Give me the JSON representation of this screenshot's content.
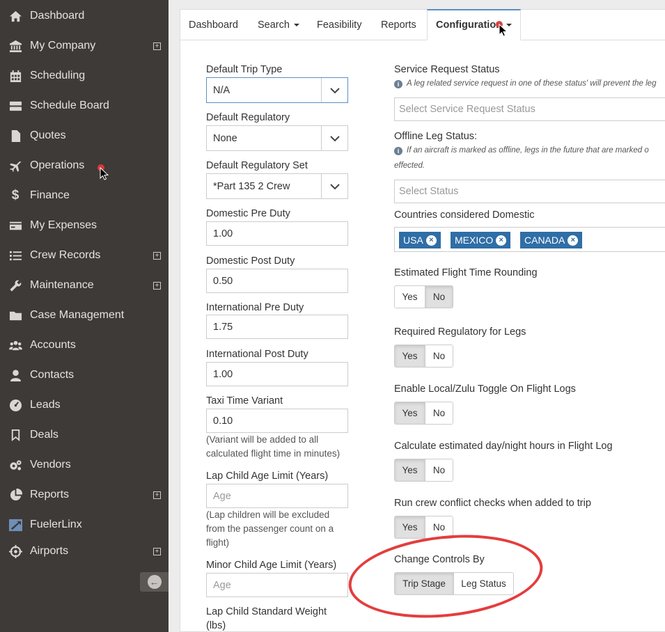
{
  "sidebar": {
    "items": [
      {
        "label": "Dashboard",
        "icon": "home-icon",
        "plus": false
      },
      {
        "label": "My Company",
        "icon": "bank-icon",
        "plus": true
      },
      {
        "label": "Scheduling",
        "icon": "calendar-icon",
        "plus": false
      },
      {
        "label": "Schedule Board",
        "icon": "board-icon",
        "plus": false
      },
      {
        "label": "Quotes",
        "icon": "document-icon",
        "plus": false
      },
      {
        "label": "Operations",
        "icon": "plane-icon",
        "plus": false
      },
      {
        "label": "Finance",
        "icon": "dollar-icon",
        "plus": false
      },
      {
        "label": "My Expenses",
        "icon": "credit-card-icon",
        "plus": false
      },
      {
        "label": "Crew Records",
        "icon": "list-icon",
        "plus": true
      },
      {
        "label": "Maintenance",
        "icon": "wrench-icon",
        "plus": true
      },
      {
        "label": "Case Management",
        "icon": "folder-icon",
        "plus": false
      },
      {
        "label": "Accounts",
        "icon": "users-icon",
        "plus": false
      },
      {
        "label": "Contacts",
        "icon": "user-icon",
        "plus": false
      },
      {
        "label": "Leads",
        "icon": "gauge-icon",
        "plus": false
      },
      {
        "label": "Deals",
        "icon": "bookmark-icon",
        "plus": false
      },
      {
        "label": "Vendors",
        "icon": "gears-icon",
        "plus": false
      },
      {
        "label": "Reports",
        "icon": "pie-chart-icon",
        "plus": true
      },
      {
        "label": "FuelerLinx",
        "icon": "fuelerlinx-icon",
        "plus": false
      },
      {
        "label": "Airports",
        "icon": "crosshair-icon",
        "plus": true
      }
    ],
    "plus_symbol": "+",
    "collapse_symbol": "←"
  },
  "tabs": [
    {
      "label": "Dashboard",
      "caret": false
    },
    {
      "label": "Search",
      "caret": true
    },
    {
      "label": "Feasibility",
      "caret": false
    },
    {
      "label": "Reports",
      "caret": false
    },
    {
      "label": "Configuration",
      "caret": true,
      "active": true
    }
  ],
  "left_form": {
    "default_trip_type": {
      "label": "Default Trip Type",
      "value": "N/A"
    },
    "default_regulatory": {
      "label": "Default Regulatory",
      "value": "None"
    },
    "default_regulatory_set": {
      "label": "Default Regulatory Set",
      "value": "*Part 135 2 Crew"
    },
    "domestic_pre_duty": {
      "label": "Domestic Pre Duty",
      "value": "1.00"
    },
    "domestic_post_duty": {
      "label": "Domestic Post Duty",
      "value": "0.50"
    },
    "international_pre_duty": {
      "label": "International Pre Duty",
      "value": "1.75"
    },
    "international_post_duty": {
      "label": "International Post Duty",
      "value": "1.00"
    },
    "taxi_time_variant": {
      "label": "Taxi Time Variant",
      "value": "0.10",
      "note_line1": "(Variant will be added to all",
      "note_line2": "calculated flight time in minutes)"
    },
    "lap_child_age_limit": {
      "label": "Lap Child Age Limit (Years)",
      "placeholder": "Age",
      "note_line1": "(Lap children will be excluded",
      "note_line2": "from the passenger count on a",
      "note_line3": "flight)"
    },
    "minor_child_age_limit": {
      "label": "Minor Child Age Limit (Years)",
      "placeholder": "Age"
    },
    "lap_child_standard_weight": {
      "label_line1": "Lap Child Standard Weight",
      "label_line2": "(lbs)"
    }
  },
  "right_form": {
    "service_request_status": {
      "label": "Service Request Status",
      "info": "A leg related service request in one of these status' will prevent the leg",
      "placeholder": "Select Service Request Status"
    },
    "offline_leg_status": {
      "label": "Offline Leg Status:",
      "info_line1": "If an aircraft is marked as offline, legs in the future that are marked o",
      "info_line2": "effected.",
      "placeholder": "Select Status"
    },
    "countries_domestic": {
      "label": "Countries considered Domestic",
      "tags": [
        "USA",
        "MEXICO",
        "CANADA"
      ],
      "remove_symbol": "×"
    },
    "toggles": [
      {
        "label": "Estimated Flight Time Rounding",
        "options": [
          "Yes",
          "No"
        ],
        "selected": "No"
      },
      {
        "label": "Required Regulatory for Legs",
        "options": [
          "Yes",
          "No"
        ],
        "selected": "Yes"
      },
      {
        "label": "Enable Local/Zulu Toggle On Flight Logs",
        "options": [
          "Yes",
          "No"
        ],
        "selected": "Yes"
      },
      {
        "label": "Calculate estimated day/night hours in Flight Log",
        "options": [
          "Yes",
          "No"
        ],
        "selected": "Yes"
      },
      {
        "label": "Run crew conflict checks when added to trip",
        "options": [
          "Yes",
          "No"
        ],
        "selected": "Yes"
      }
    ],
    "change_controls": {
      "label": "Change Controls By",
      "options": [
        "Trip Stage",
        "Leg Status"
      ],
      "selected": "Trip Stage"
    }
  },
  "info_symbol": "i",
  "colors": {
    "sidebar_bg": "#3e3a37",
    "tag_bg": "#2f6ea6",
    "highlight": "#e43d3d",
    "active_tab_border": "#5b8fc2"
  }
}
